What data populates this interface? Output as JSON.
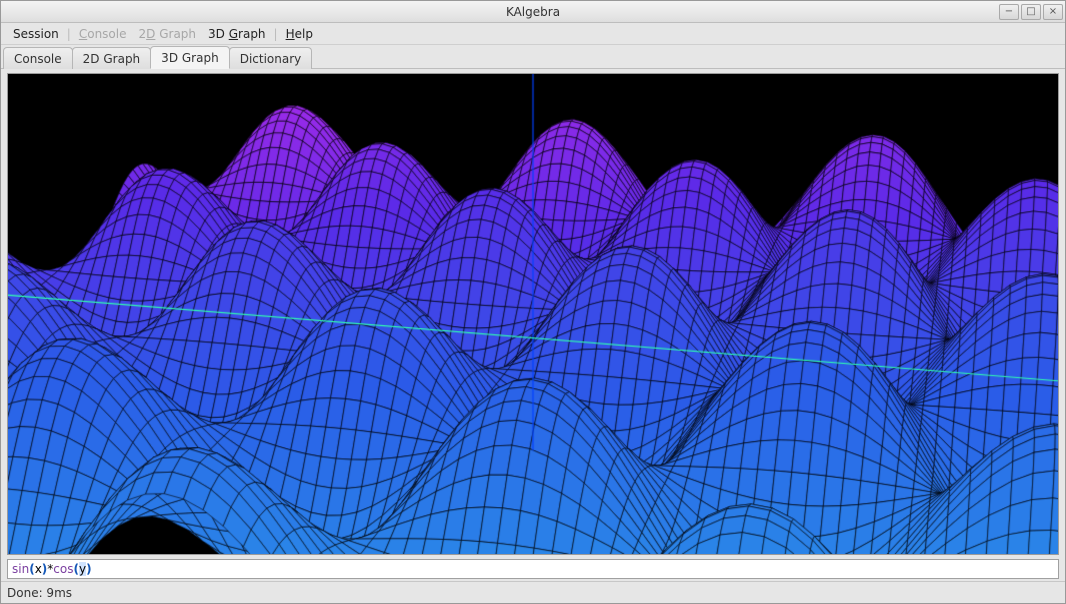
{
  "window": {
    "title": "KAlgebra"
  },
  "window_controls": {
    "min": "−",
    "max": "□",
    "close": "×"
  },
  "menu": {
    "session": "Session",
    "console": "Console",
    "graph2d": "2D Graph",
    "graph3d": "3D Graph",
    "help": "Help",
    "sep": "|"
  },
  "tabs": {
    "console": "Console",
    "graph2d": "2D Graph",
    "graph3d": "3D Graph",
    "dictionary": "Dictionary",
    "active": "graph3d"
  },
  "chart_data": {
    "type": "surface",
    "function": "sin(x)*cos(y)",
    "x_range": [
      -10,
      10
    ],
    "y_range": [
      -10,
      10
    ],
    "z_range": [
      -1,
      1
    ],
    "grid_resolution": 90,
    "colormap": [
      "#30e0d8",
      "#2aa8e8",
      "#2a5ce8",
      "#5a2ae8",
      "#b42ae8",
      "#e82ab8"
    ],
    "background": "#000000",
    "axis_lines": [
      {
        "axis": "z",
        "color": "#0040ff"
      },
      {
        "axis": "x",
        "color": "#30ffb0"
      }
    ],
    "wireframe_color": "#000000"
  },
  "input": {
    "value": "sin(x)*cos(y)",
    "tokens": [
      {
        "t": "sin",
        "c": "fn"
      },
      {
        "t": "(",
        "c": "paren"
      },
      {
        "t": "x",
        "c": "var"
      },
      {
        "t": ")",
        "c": "paren"
      },
      {
        "t": "*",
        "c": "var"
      },
      {
        "t": "cos",
        "c": "fn"
      },
      {
        "t": "(",
        "c": "paren"
      },
      {
        "t": "y",
        "c": "var sel"
      },
      {
        "t": ")",
        "c": "paren"
      }
    ]
  },
  "status": {
    "text": "Done: 9ms"
  }
}
